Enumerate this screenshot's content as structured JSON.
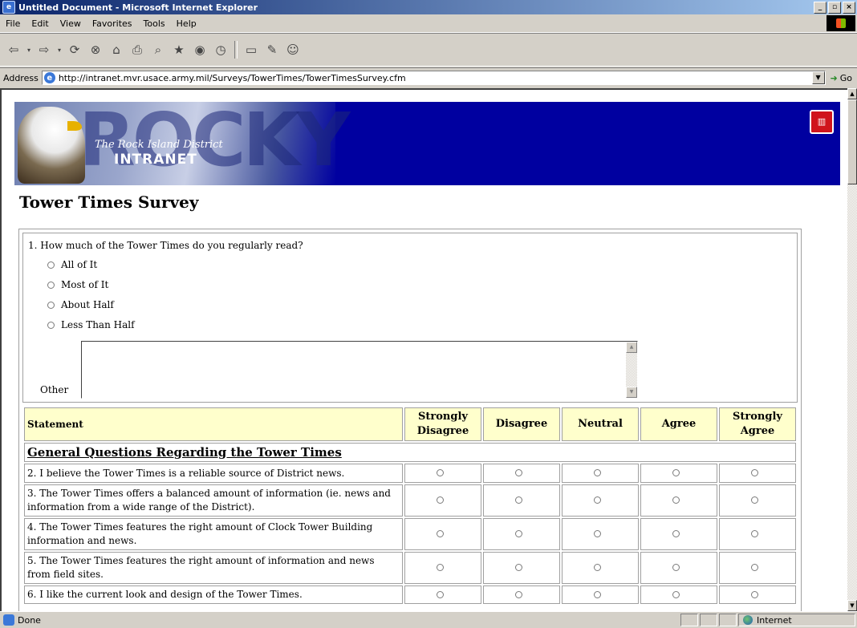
{
  "window": {
    "title": "Untitled Document - Microsoft Internet Explorer",
    "controls": [
      "_",
      "▫",
      "×"
    ]
  },
  "menu": [
    "File",
    "Edit",
    "View",
    "Favorites",
    "Tools",
    "Help"
  ],
  "address": {
    "label": "Address",
    "url": "http://intranet.mvr.usace.army.mil/Surveys/TowerTimes/TowerTimesSurvey.cfm",
    "go_label": "Go"
  },
  "banner": {
    "big_text": "ROCKY",
    "subtitle": "The Rock Island District",
    "title": "INTRANET"
  },
  "page": {
    "title": "Tower Times Survey"
  },
  "q1": {
    "text": "1. How much of the Tower Times do you regularly read?",
    "options": [
      "All of It",
      "Most of It",
      "About Half",
      "Less Than Half"
    ],
    "other_label": "Other"
  },
  "table": {
    "headers": [
      "Statement",
      "Strongly Disagree",
      "Disagree",
      "Neutral",
      "Agree",
      "Strongly Agree"
    ],
    "section_title": "General Questions Regarding the Tower Times",
    "rows": [
      "2. I believe the Tower Times is a reliable source of District news.",
      "3. The Tower Times offers a balanced amount of information (ie. news and information from a wide range of the District).",
      "4. The Tower Times features the right amount of Clock Tower Building information and news.",
      "5. The Tower Times features the right amount of information and news from field sites.",
      "6. I like the current look and design of the Tower Times."
    ]
  },
  "status": {
    "text": "Done",
    "zone": "Internet"
  }
}
